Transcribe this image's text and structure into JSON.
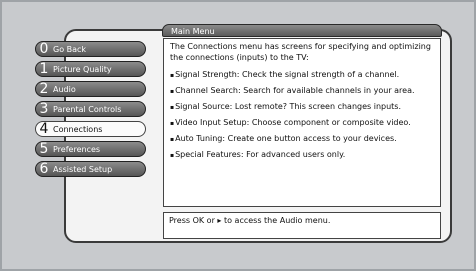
{
  "menu": {
    "title": "Main Menu",
    "items": [
      {
        "number": "0",
        "label": "Go Back"
      },
      {
        "number": "1",
        "label": "Picture Quality"
      },
      {
        "number": "2",
        "label": "Audio"
      },
      {
        "number": "3",
        "label": "Parental Controls"
      },
      {
        "number": "4",
        "label": "Connections",
        "selected": true
      },
      {
        "number": "5",
        "label": "Preferences"
      },
      {
        "number": "6",
        "label": "Assisted Setup"
      }
    ]
  },
  "content": {
    "intro": "The Connections menu has screens for specifying and optimizing the connections (inputs) to the TV:",
    "bullets": [
      "Signal Strength: Check the signal strength of a channel.",
      "Channel Search: Search for available channels in your area.",
      "Signal Source: Lost remote? This screen changes inputs.",
      "Video Input Setup: Choose component or composite video.",
      "Auto Tuning: Create one button access to your devices.",
      "Special Features: For advanced users only."
    ]
  },
  "footer": {
    "text": "Press OK or ▸ to access the Audio menu."
  }
}
